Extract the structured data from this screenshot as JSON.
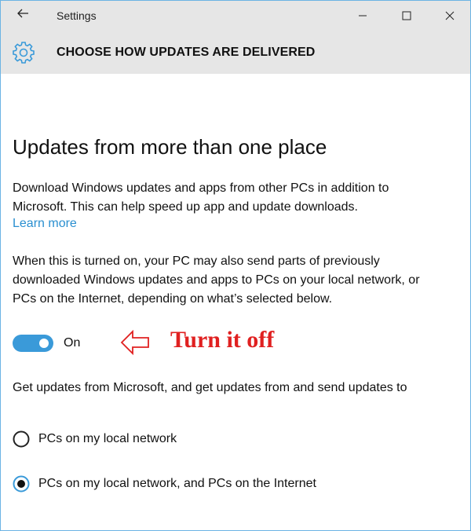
{
  "window": {
    "title": "Settings",
    "back_icon": "arrow-left-icon",
    "minimize_icon": "minimize-icon",
    "maximize_icon": "maximize-icon",
    "close_icon": "close-icon"
  },
  "header": {
    "icon": "gear-icon",
    "title": "CHOOSE HOW UPDATES ARE DELIVERED",
    "accent_color": "#3a9ad9"
  },
  "main": {
    "heading": "Updates from more than one place",
    "description": "Download Windows updates and apps from other PCs in addition to Microsoft. This can help speed up app and update downloads.",
    "learn_more": "Learn more",
    "detail": "When this is turned on, your PC may also send parts of previously downloaded Windows updates and apps to PCs on your local network, or PCs on the Internet, depending on what’s selected below.",
    "toggle": {
      "state": "on",
      "label": "On"
    },
    "annotation": {
      "icon": "arrow-left-outline-icon",
      "text": "Turn it off",
      "color": "#e02020"
    },
    "options_intro": "Get updates from Microsoft, and get updates from and send updates to",
    "options": [
      {
        "label": "PCs on my local network",
        "selected": false
      },
      {
        "label": "PCs on my local network, and PCs on the Internet",
        "selected": true
      }
    ]
  }
}
